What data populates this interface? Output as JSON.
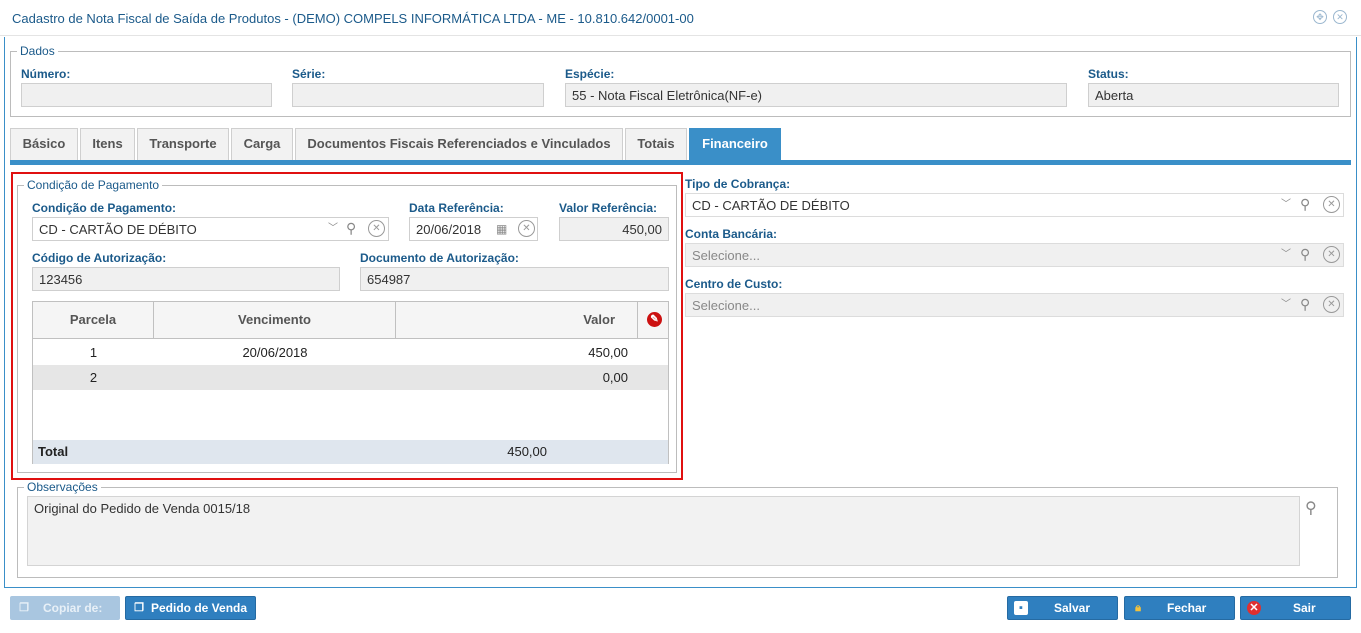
{
  "window": {
    "title": "Cadastro de Nota Fiscal de Saída de Produtos - (DEMO) COMPELS INFORMÁTICA LTDA - ME - 10.810.642/0001-00"
  },
  "dados": {
    "legend": "Dados",
    "numero_label": "Número:",
    "numero_value": "",
    "serie_label": "Série:",
    "serie_value": "",
    "especie_label": "Espécie:",
    "especie_value": "55 - Nota Fiscal Eletrônica(NF-e)",
    "status_label": "Status:",
    "status_value": "Aberta"
  },
  "tabs": [
    {
      "label": "Básico",
      "active": false
    },
    {
      "label": "Itens",
      "active": false
    },
    {
      "label": "Transporte",
      "active": false
    },
    {
      "label": "Carga",
      "active": false
    },
    {
      "label": "Documentos Fiscais Referenciados e Vinculados",
      "active": false
    },
    {
      "label": "Totais",
      "active": false
    },
    {
      "label": "Financeiro",
      "active": true
    }
  ],
  "pagamento": {
    "legend": "Condição de Pagamento",
    "condicao_label": "Condição de Pagamento:",
    "condicao_value": "CD - CARTÃO DE DÉBITO",
    "data_ref_label": "Data Referência:",
    "data_ref_value": "20/06/2018",
    "valor_ref_label": "Valor Referência:",
    "valor_ref_value": "450,00",
    "cod_aut_label": "Código de Autorização:",
    "cod_aut_value": "123456",
    "doc_aut_label": "Documento de Autorização:",
    "doc_aut_value": "654987",
    "grid": {
      "headers": [
        "Parcela",
        "Vencimento",
        "Valor"
      ],
      "rows": [
        {
          "parcela": "1",
          "vencimento": "20/06/2018",
          "valor": "450,00"
        },
        {
          "parcela": "2",
          "vencimento": "",
          "valor": "0,00"
        }
      ],
      "total_label": "Total",
      "total_value": "450,00"
    }
  },
  "cobranca": {
    "tipo_label": "Tipo de Cobrança:",
    "tipo_value": "CD - CARTÃO DE DÉBITO",
    "conta_label": "Conta Bancária:",
    "conta_placeholder": "Selecione...",
    "centro_label": "Centro de Custo:",
    "centro_placeholder": "Selecione..."
  },
  "observacoes": {
    "legend": "Observações",
    "text": "Original do Pedido de Venda 0015/18"
  },
  "footer": {
    "copiar_label": "Copiar de:",
    "pedido_label": "Pedido de Venda",
    "salvar_label": "Salvar",
    "fechar_label": "Fechar",
    "sair_label": "Sair"
  },
  "colors": {
    "accent": "#3a8fc8",
    "label": "#1b5a8a",
    "highlight": "#e01010"
  }
}
